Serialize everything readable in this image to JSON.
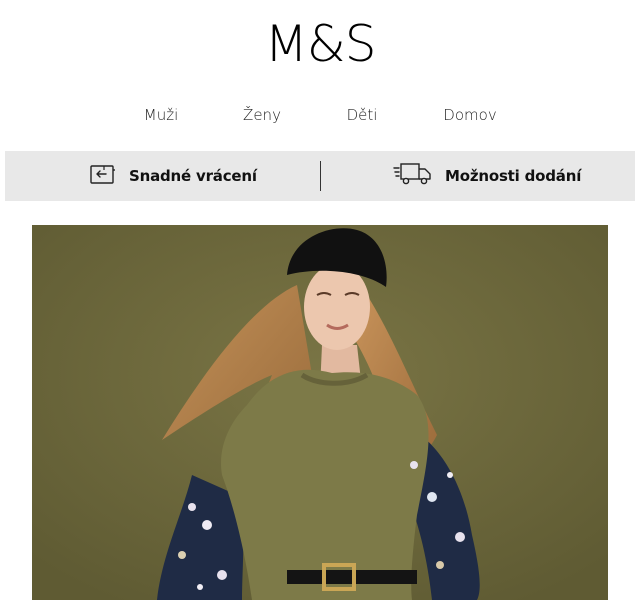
{
  "brand": {
    "logo_text": "M&S"
  },
  "nav": {
    "items": [
      {
        "label": "Muži"
      },
      {
        "label": "Ženy"
      },
      {
        "label": "Děti"
      },
      {
        "label": "Domov"
      }
    ]
  },
  "service_bar": {
    "returns_label": "Snadné vrácení",
    "returns_icon": "return-package-icon",
    "delivery_label": "Možnosti dodání",
    "delivery_icon": "delivery-truck-icon"
  },
  "hero": {
    "image": "woman-olive-knit-vest-black-beanie-floral-blouse",
    "background_color": "#6e6a3c"
  }
}
